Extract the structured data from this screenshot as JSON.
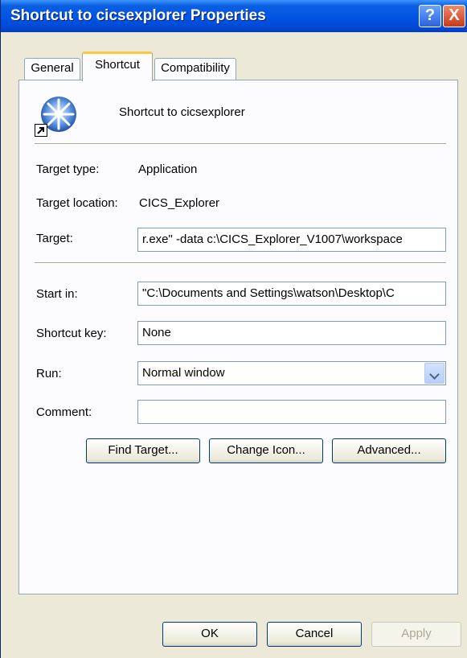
{
  "window": {
    "title": "Shortcut to cicsexplorer Properties",
    "help_label": "?",
    "close_label": "X"
  },
  "tabs": {
    "general": "General",
    "shortcut": "Shortcut",
    "compatibility": "Compatibility"
  },
  "shortcut": {
    "name": "Shortcut to cicsexplorer",
    "target_type_label": "Target type:",
    "target_type_value": "Application",
    "target_location_label": "Target location:",
    "target_location_value": "CICS_Explorer",
    "target_label": "Target:",
    "target_value": "r.exe\" -data c:\\CICS_Explorer_V1007\\workspace",
    "start_in_label": "Start in:",
    "start_in_value": "\"C:\\Documents and Settings\\watson\\Desktop\\C",
    "shortcut_key_label": "Shortcut key:",
    "shortcut_key_value": "None",
    "run_label": "Run:",
    "run_value": "Normal window",
    "comment_label": "Comment:",
    "comment_value": ""
  },
  "buttons": {
    "find_target": "Find Target...",
    "change_icon": "Change Icon...",
    "advanced": "Advanced...",
    "ok": "OK",
    "cancel": "Cancel",
    "apply": "Apply"
  },
  "icons": {
    "app": "starburst-icon",
    "shortcut_overlay": "shortcut-arrow-icon"
  }
}
